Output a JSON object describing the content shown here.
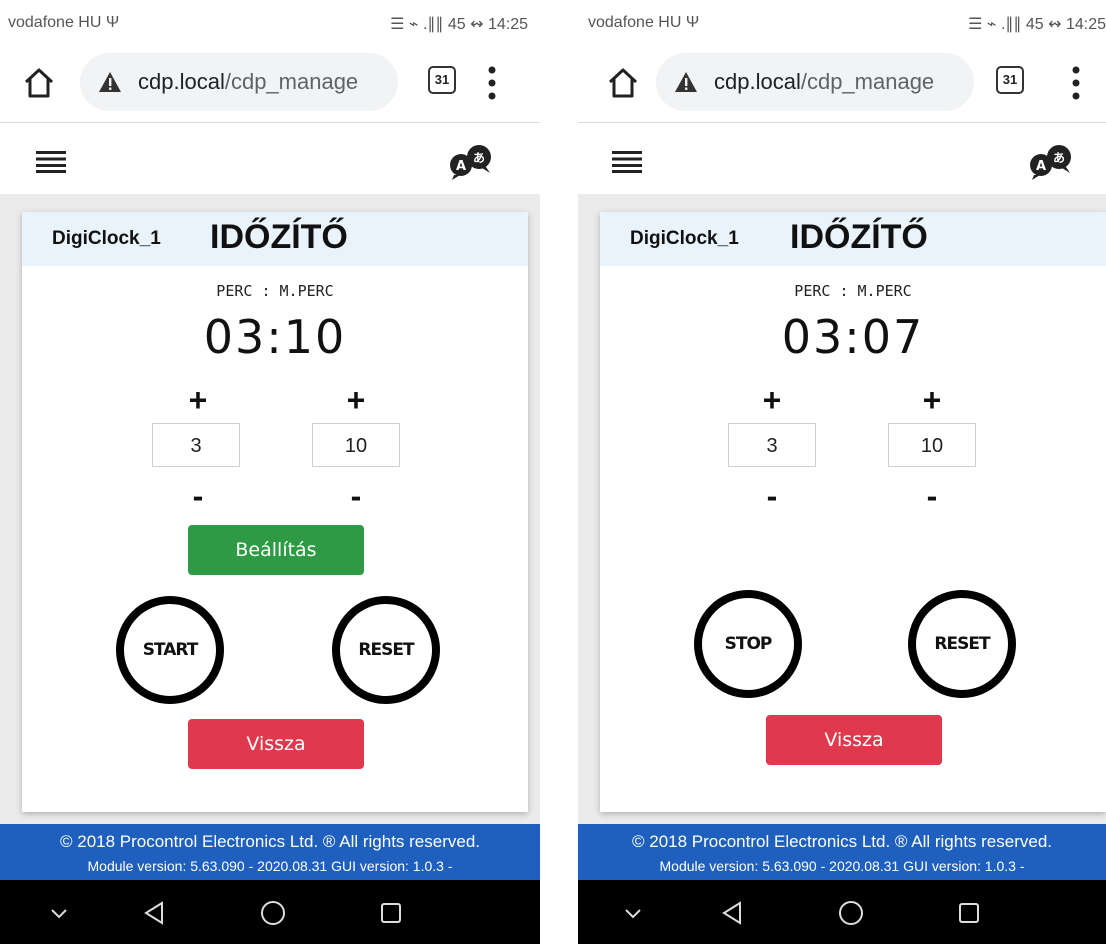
{
  "screens": [
    {
      "status": {
        "carrier": "vodafone HU Ψ",
        "icons": "☰ ⌁ .∥∥ 45 ↭",
        "time": "14:25"
      },
      "browser": {
        "url_host": "cdp.local",
        "url_path": "/cdp_manage",
        "tab_count": "31"
      },
      "card": {
        "device_name": "DigiClock_1",
        "title": "IDŐZÍTŐ",
        "format_label": "PERC : M.PERC",
        "time": "03:10",
        "plus_min": "+",
        "plus_sec": "+",
        "minutes_value": "3",
        "seconds_value": "10",
        "minus_min": "-",
        "minus_sec": "-",
        "set_button": "Beállítás",
        "primary_round_button": "START",
        "reset_button": "RESET",
        "back_button": "Vissza"
      },
      "footer": {
        "copyright": "© 2018 Procontrol Electronics Ltd. ® All rights reserved.",
        "versions": "Module version: 5.63.090 - 2020.08.31    GUI version: 1.0.3 -"
      }
    },
    {
      "status": {
        "carrier": "vodafone HU Ψ",
        "icons": "☰ ⌁ .∥∥ 45 ↭",
        "time": "14:25"
      },
      "browser": {
        "url_host": "cdp.local",
        "url_path": "/cdp_manage",
        "tab_count": "31"
      },
      "card": {
        "device_name": "DigiClock_1",
        "title": "IDŐZÍTŐ",
        "format_label": "PERC : M.PERC",
        "time": "03:07",
        "plus_min": "+",
        "plus_sec": "+",
        "minutes_value": "3",
        "seconds_value": "10",
        "minus_min": "-",
        "minus_sec": "-",
        "primary_round_button": "STOP",
        "reset_button": "RESET",
        "back_button": "Vissza"
      },
      "footer": {
        "copyright": "© 2018 Procontrol Electronics Ltd. ® All rights reserved.",
        "versions": "Module version: 5.63.090 - 2020.08.31    GUI version: 1.0.3 -"
      }
    }
  ],
  "colors": {
    "accent_green": "#2e9a43",
    "accent_red": "#e0384c",
    "footer_blue": "#1f5fbd",
    "header_blue": "#e8f3fc"
  }
}
